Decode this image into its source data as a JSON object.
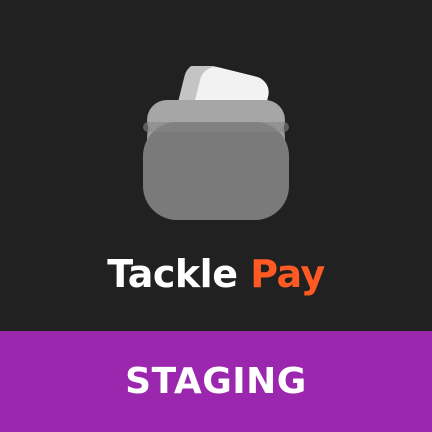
{
  "brand": {
    "name_primary": "Tackle",
    "name_accent": "Pay",
    "icon": "wallet-icon",
    "colors": {
      "background": "#212121",
      "text": "#ffffff",
      "accent": "#ff5a24",
      "icon_body": "#7a7a7a",
      "icon_card": "#f2f2f2"
    }
  },
  "banner": {
    "label": "STAGING",
    "color": "#9b27ae"
  }
}
